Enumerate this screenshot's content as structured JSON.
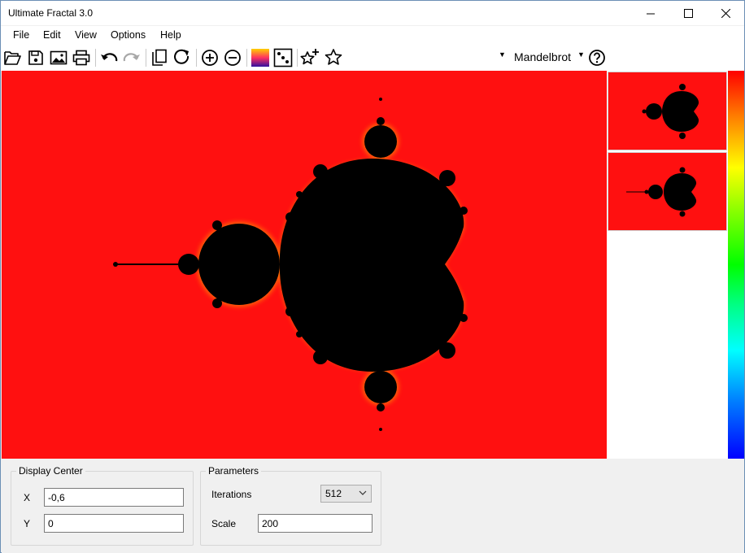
{
  "window": {
    "title": "Ultimate Fractal 3.0"
  },
  "menu": {
    "items": [
      "File",
      "Edit",
      "View",
      "Options",
      "Help"
    ]
  },
  "toolbar": {
    "icons": [
      "open-folder-icon",
      "save-icon",
      "export-image-icon",
      "print-icon",
      "undo-icon",
      "redo-icon",
      "copy-icon",
      "refresh-icon",
      "zoom-in-icon",
      "zoom-out-icon",
      "palette-icon",
      "random-icon",
      "add-favorite-icon",
      "favorites-icon",
      "help-icon"
    ],
    "fractal_type": "Mandelbrot"
  },
  "colors": {
    "fractal_background": "#ff1010",
    "set_color": "#000000"
  },
  "display_center": {
    "legend": "Display Center",
    "x_label": "X",
    "x_value": "-0,6",
    "y_label": "Y",
    "y_value": "0"
  },
  "parameters": {
    "legend": "Parameters",
    "iterations_label": "Iterations",
    "iterations_value": "512",
    "scale_label": "Scale",
    "scale_value": "200"
  }
}
